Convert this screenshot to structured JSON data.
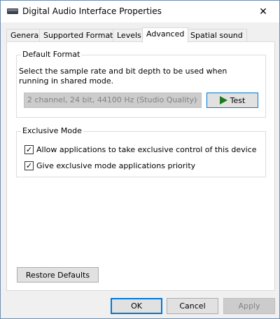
{
  "window": {
    "title": "Digital Audio Interface Properties",
    "close_glyph": "✕"
  },
  "tabs": [
    {
      "label": "General"
    },
    {
      "label": "Supported Formats"
    },
    {
      "label": "Levels"
    },
    {
      "label": "Advanced"
    },
    {
      "label": "Spatial sound"
    }
  ],
  "default_format": {
    "legend": "Default Format",
    "description": "Select the sample rate and bit depth to be used when running in shared mode.",
    "selected_format": "2 channel, 24 bit, 44100 Hz (Studio Quality)",
    "test_label": "Test"
  },
  "exclusive_mode": {
    "legend": "Exclusive Mode",
    "options": [
      {
        "label": "Allow applications to take exclusive control of this device",
        "checked": true
      },
      {
        "label": "Give exclusive mode applications priority",
        "checked": true
      }
    ]
  },
  "restore_defaults_label": "Restore Defaults",
  "footer": {
    "ok_label": "OK",
    "cancel_label": "Cancel",
    "apply_label": "Apply"
  },
  "colors": {
    "accent": "#0078d7",
    "play_icon": "#1b7a1b"
  },
  "icons": {
    "app": "speaker-icon",
    "close": "close-icon",
    "test": "play-icon",
    "combo": "chevron-down-icon"
  }
}
